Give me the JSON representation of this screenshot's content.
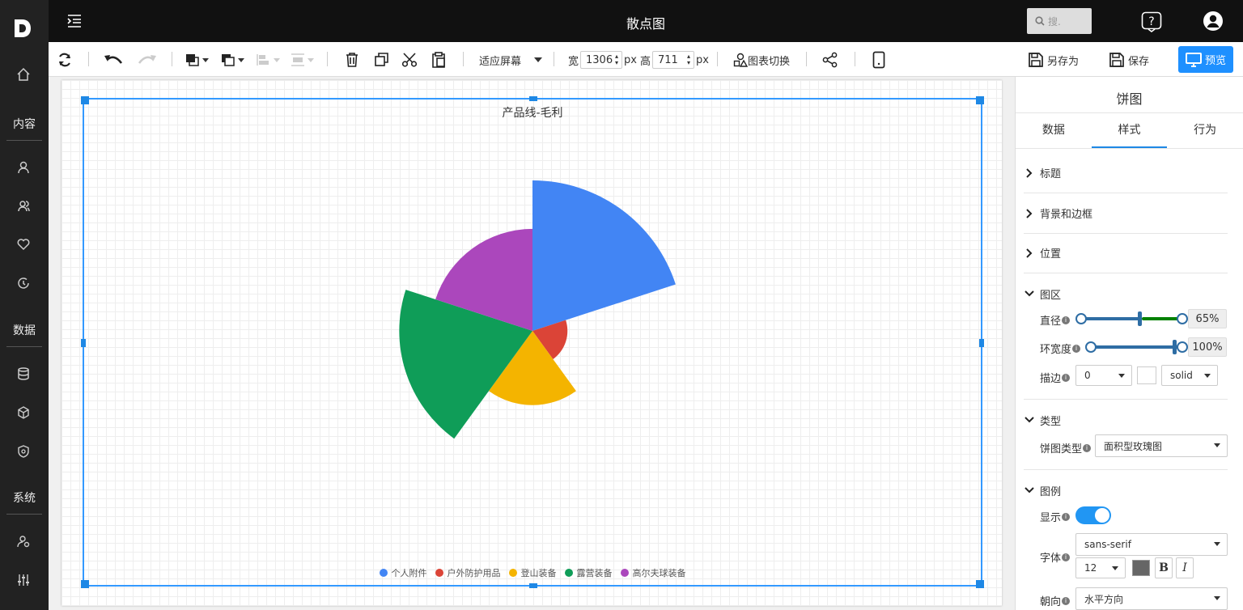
{
  "app": {
    "title": "散点图"
  },
  "sidebar": {
    "sections": [
      "内容",
      "数据",
      "系统"
    ]
  },
  "header": {
    "search_placeholder": "搜."
  },
  "toolbar": {
    "zoom": "适应屏幕",
    "width_label": "宽",
    "width_value": "1306",
    "height_label": "高",
    "height_value": "711",
    "unit": "px",
    "switch_chart": "图表切换",
    "save_as": "另存为",
    "save": "保存",
    "preview": "预览"
  },
  "chart_data": {
    "type": "pie",
    "rose_type": "area",
    "title": "产品线-毛利",
    "categories": [
      "个人附件",
      "户外防护用品",
      "登山装备",
      "露营装备",
      "高尔夫球装备"
    ],
    "values": [
      185,
      10,
      45,
      145,
      85
    ],
    "colors": [
      "#4285f4",
      "#db4437",
      "#f4b400",
      "#0f9d58",
      "#ab47bc"
    ],
    "legend_position": "bottom"
  },
  "panel": {
    "title": "饼图",
    "tabs": [
      "数据",
      "样式",
      "行为"
    ],
    "sections": [
      "标题",
      "背景和边框",
      "位置",
      "图区",
      "类型",
      "图例"
    ],
    "diameter_label": "直径",
    "diameter_value": "65%",
    "ring_label": "环宽度",
    "ring_value": "100%",
    "border_label": "描边",
    "border_width": "0",
    "border_style": "solid",
    "pie_type_label": "饼图类型",
    "pie_type_value": "面积型玫瑰图",
    "show_label": "显示",
    "font_label": "字体",
    "font_value": "sans-serif",
    "font_size": "12",
    "bold": "B",
    "italic": "I",
    "orient_label": "朝向",
    "orient_value": "水平方向"
  }
}
